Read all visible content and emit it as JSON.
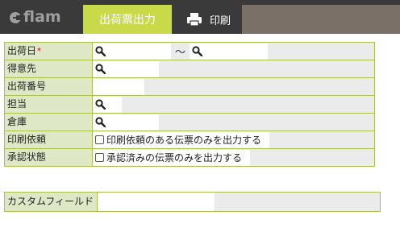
{
  "app": {
    "logo": "flam"
  },
  "tabs": [
    {
      "label": "出荷票出力",
      "active": true
    },
    {
      "label": "印刷",
      "icon": "printer-icon"
    }
  ],
  "form": {
    "ship_date_label": "出荷日",
    "required_mark": "*",
    "range_separator": "～",
    "customer_label": "得意先",
    "ship_number_label": "出荷番号",
    "assignee_label": "担当",
    "warehouse_label": "倉庫",
    "print_request_label": "印刷依頼",
    "print_request_checkbox": "印刷依頼のある伝票のみを出力する",
    "approval_label": "承認状態",
    "approval_checkbox": "承認済みの伝票のみを出力する",
    "custom_field_label": "カスタムフィールド"
  },
  "colors": {
    "accent": "#c8d94a",
    "label_bg": "#dfe8c6",
    "border": "#a9c24a",
    "topbar": "#3a3a3a"
  }
}
